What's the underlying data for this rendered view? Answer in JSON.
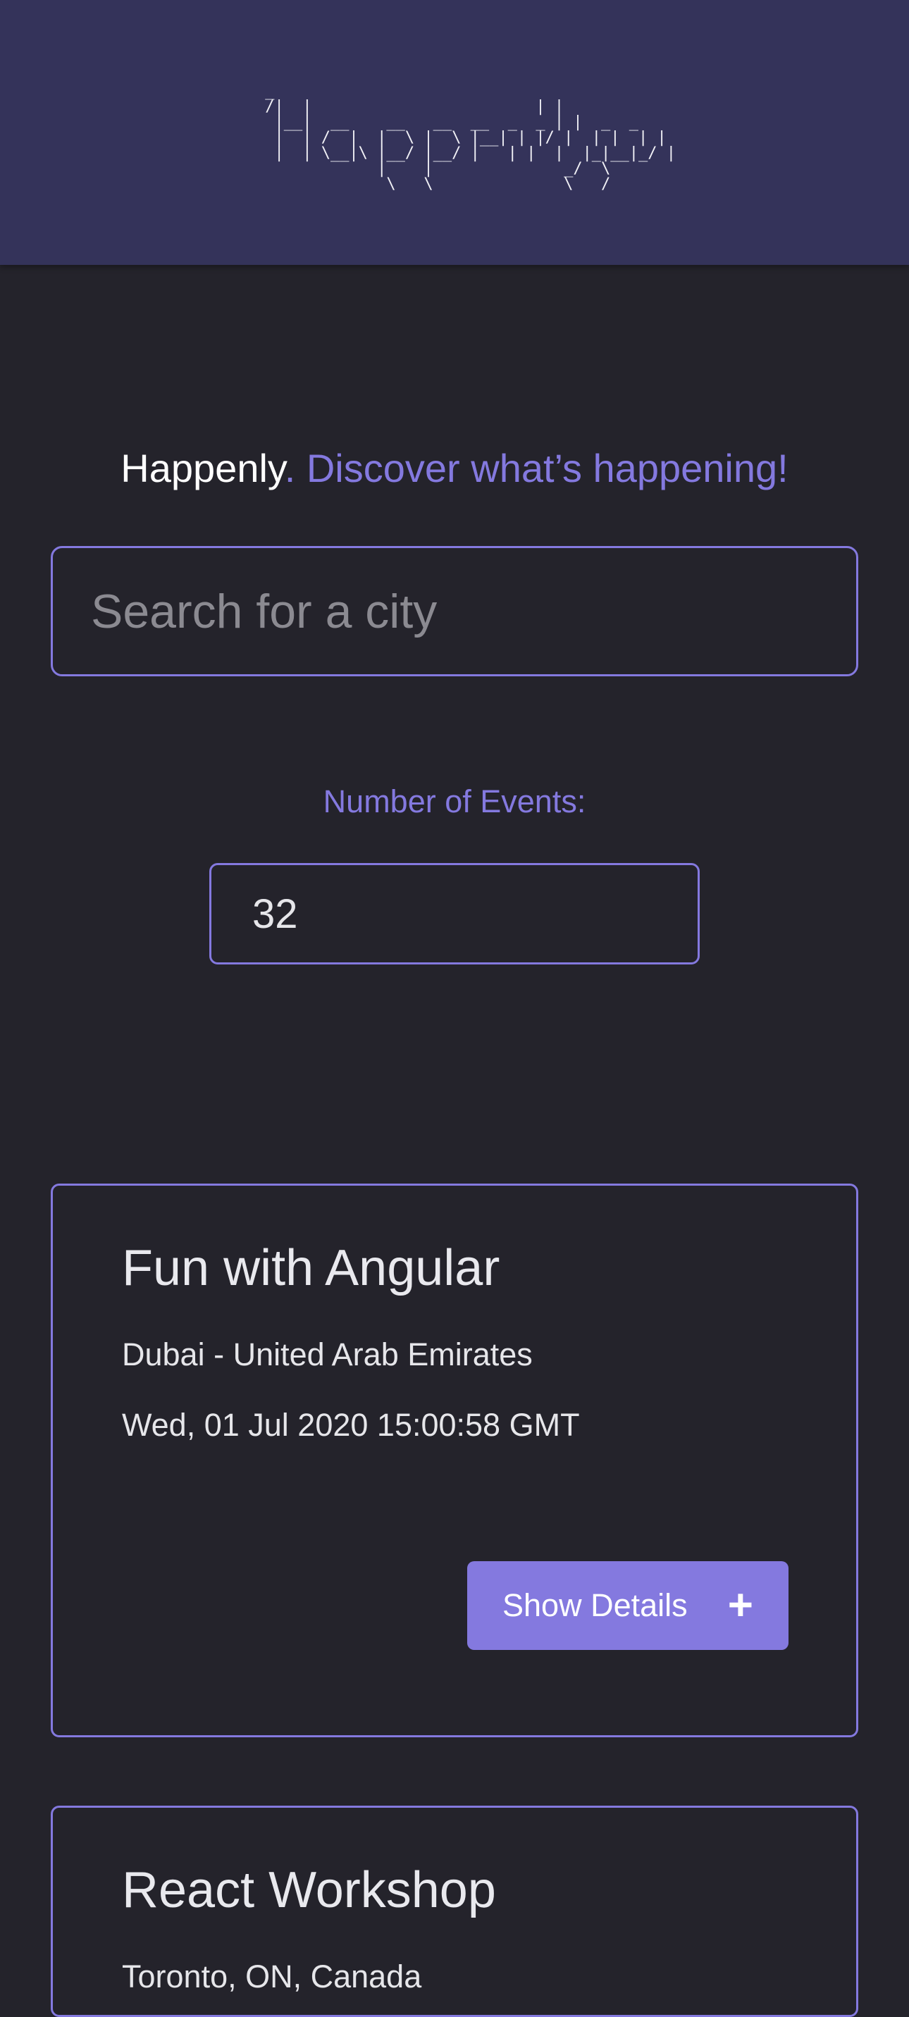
{
  "header": {
    "logo_ascii": " _     \n /|  |                        | |     \n  |__|  __    __   __  __  _  _ | |  _  _\n  |  | /  |  |  \\ |  \\ |__| | |/ |  | |  | |\n  |  | \\__|\\ |__/ |__/ |   | |  |  |_|__|_/ |\n             |    |              _/  \\\n              \\   \\              \\   /",
    "logo_name": "Happenly"
  },
  "tagline": {
    "brand": "Happenly",
    "slogan": ". Discover what’s happening!"
  },
  "search": {
    "placeholder": "Search for a city",
    "value": ""
  },
  "events_count": {
    "label": "Number of Events:",
    "value": "32"
  },
  "events": [
    {
      "title": "Fun with Angular",
      "location": "Dubai - United Arab Emirates",
      "date": "Wed, 01 Jul 2020 15:00:58 GMT",
      "button_label": "Show Details",
      "button_icon": "plus-icon"
    },
    {
      "title": "React Workshop",
      "location": "Toronto, ON, Canada"
    }
  ],
  "colors": {
    "accent": "#8479df",
    "header_bg": "#34335a",
    "page_bg": "#24232b"
  }
}
